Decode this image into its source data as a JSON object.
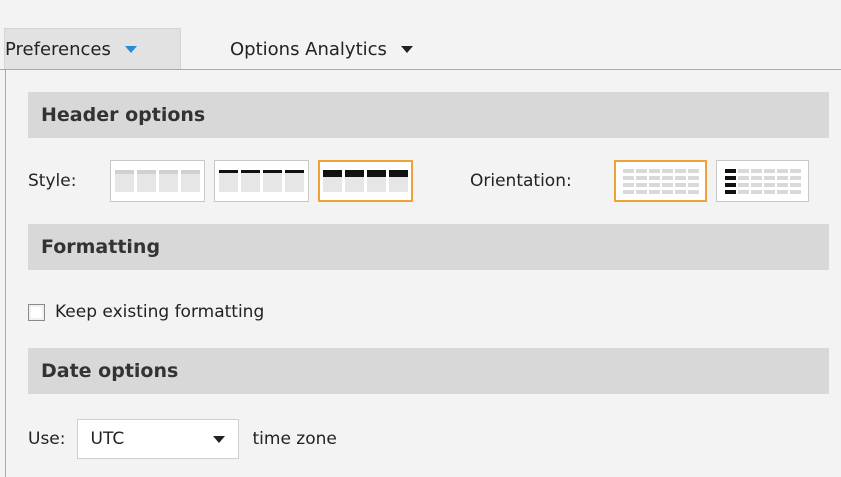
{
  "menu": {
    "tabs": [
      {
        "label": "Preferences",
        "active": true,
        "caret_color": "#2a8ad4"
      },
      {
        "label": "Options Analytics",
        "active": false,
        "caret_color": "#222222"
      }
    ]
  },
  "sections": {
    "header_options": {
      "title": "Header options",
      "style_label": "Style:",
      "style_options": [
        "light-header-style",
        "thin-dark-header-style",
        "bold-dark-header-style"
      ],
      "style_selected": "bold-dark-header-style",
      "orientation_label": "Orientation:",
      "orientation_options": [
        "horizontal-header",
        "vertical-header"
      ],
      "orientation_selected": "horizontal-header"
    },
    "formatting": {
      "title": "Formatting",
      "keep_existing_label": "Keep existing formatting",
      "keep_existing_checked": false
    },
    "date_options": {
      "title": "Date options",
      "use_label": "Use:",
      "timezone_value": "UTC",
      "timezone_suffix": "time zone"
    }
  },
  "colors": {
    "selected_border": "#f0a23a",
    "section_header_bg": "#d8d8d8",
    "panel_bg": "#f3f3f3"
  }
}
